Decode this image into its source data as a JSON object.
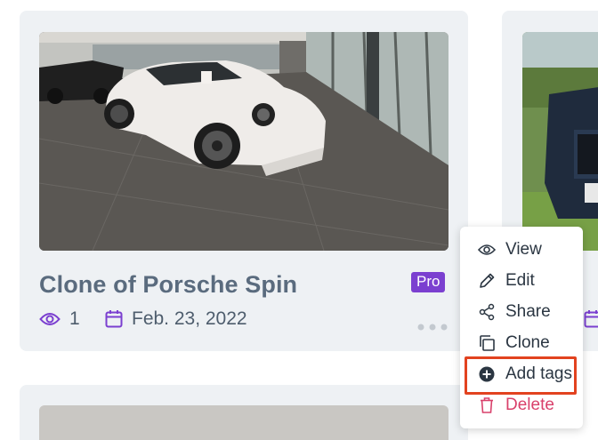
{
  "card": {
    "title": "Clone of Porsche Spin",
    "badge": "Pro",
    "views": "1",
    "date": "Feb. 23, 2022"
  },
  "menu": {
    "items": [
      {
        "label": "View",
        "icon": "eye-icon"
      },
      {
        "label": "Edit",
        "icon": "pencil-icon"
      },
      {
        "label": "Share",
        "icon": "share-icon"
      },
      {
        "label": "Clone",
        "icon": "copy-icon"
      },
      {
        "label": "Add tags",
        "icon": "plus-circle-icon"
      },
      {
        "label": "Delete",
        "icon": "trash-icon"
      }
    ],
    "highlighted": "Add tags"
  },
  "colors": {
    "accent": "#7b3fd0",
    "title": "#5a6b7e",
    "danger": "#d9416b",
    "highlight_border": "#e2421f",
    "card_bg": "#eef1f4"
  }
}
